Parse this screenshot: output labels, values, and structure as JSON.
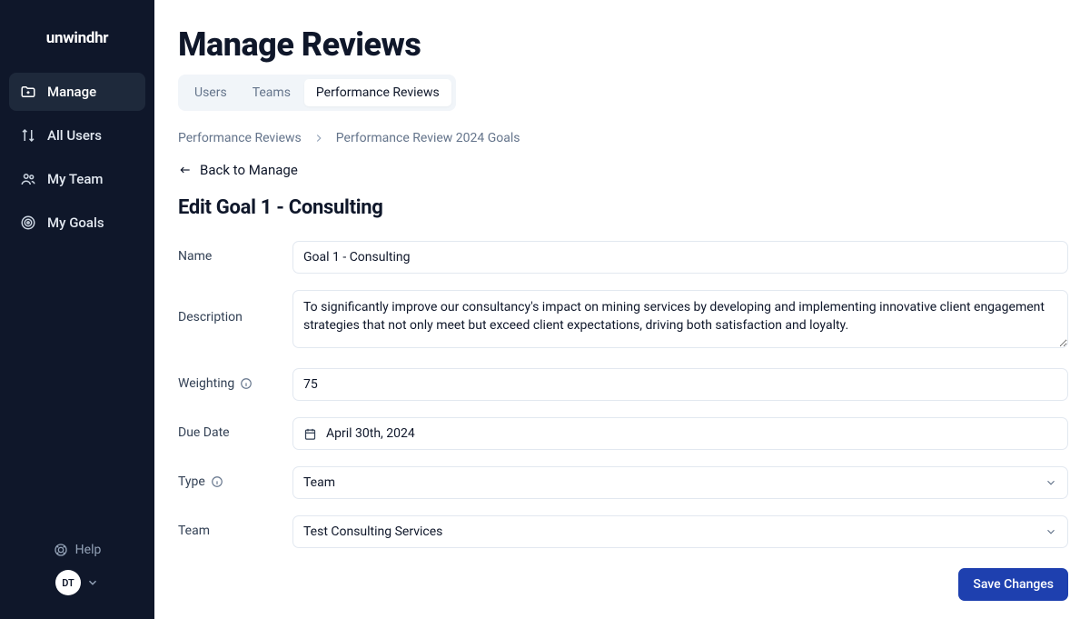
{
  "brand": "unwindhr",
  "sidebar": {
    "items": [
      {
        "label": "Manage"
      },
      {
        "label": "All Users"
      },
      {
        "label": "My Team"
      },
      {
        "label": "My Goals"
      }
    ],
    "help_label": "Help",
    "avatar_initials": "DT"
  },
  "header": {
    "title": "Manage Reviews",
    "tabs": [
      {
        "label": "Users"
      },
      {
        "label": "Teams"
      },
      {
        "label": "Performance Reviews"
      }
    ]
  },
  "breadcrumbs": {
    "crumb1": "Performance Reviews",
    "crumb2": "Performance Review 2024 Goals"
  },
  "back_link": "Back to Manage",
  "section_title": "Edit Goal 1 - Consulting",
  "form": {
    "name": {
      "label": "Name",
      "value": "Goal 1 - Consulting"
    },
    "description": {
      "label": "Description",
      "value": "To significantly improve our consultancy's impact on mining services by developing and implementing innovative client engagement strategies that not only meet but exceed client expectations, driving both satisfaction and loyalty."
    },
    "weighting": {
      "label": "Weighting",
      "value": "75"
    },
    "due_date": {
      "label": "Due Date",
      "value": "April 30th, 2024"
    },
    "type": {
      "label": "Type",
      "value": "Team"
    },
    "team": {
      "label": "Team",
      "value": "Test Consulting Services"
    }
  },
  "actions": {
    "save_label": "Save Changes"
  }
}
